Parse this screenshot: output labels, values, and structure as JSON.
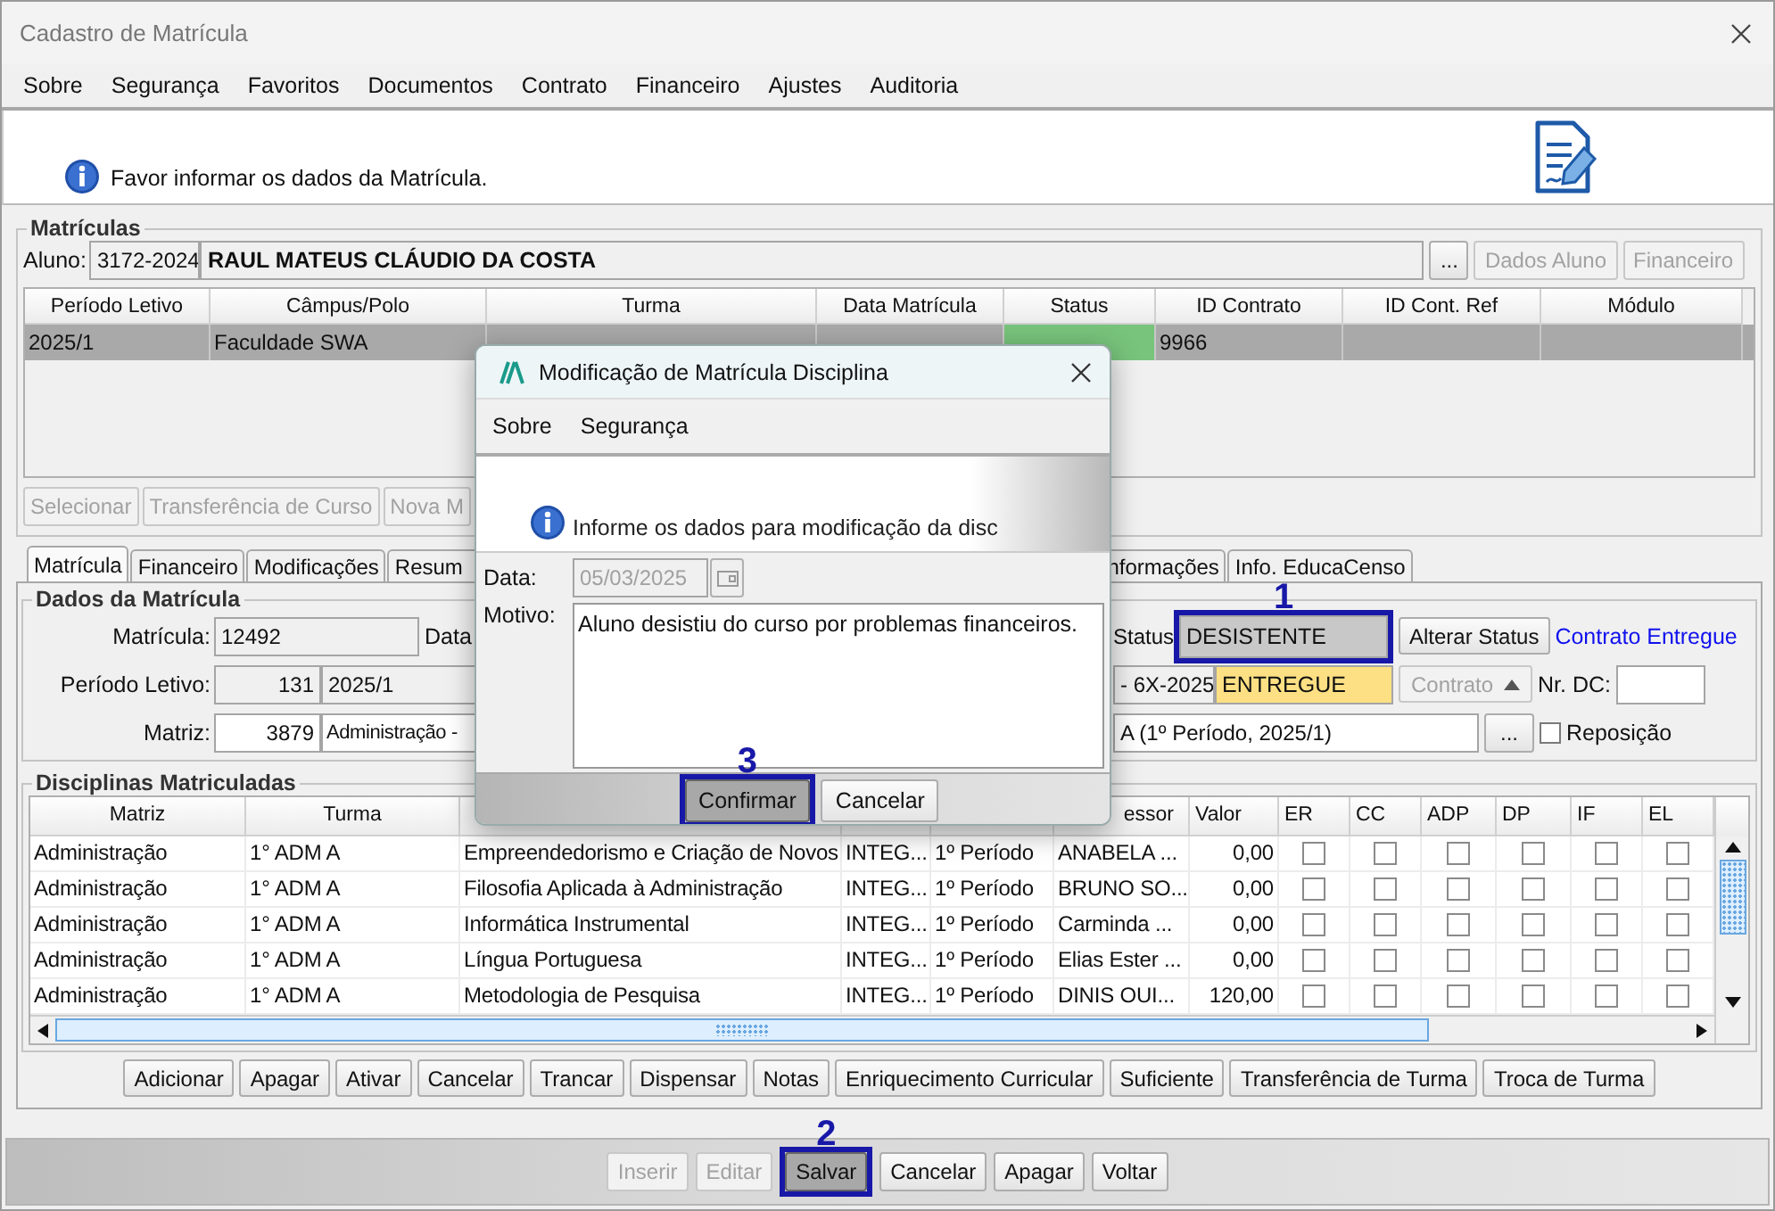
{
  "window": {
    "title": "Cadastro de Matrícula"
  },
  "menu": [
    "Sobre",
    "Segurança",
    "Favoritos",
    "Documentos",
    "Contrato",
    "Financeiro",
    "Ajustes",
    "Auditoria"
  ],
  "info": {
    "message": "Favor informar os dados da Matrícula."
  },
  "matriculas": {
    "title": "Matrículas",
    "aluno_label": "Aluno:",
    "aluno_code": "3172-2024",
    "aluno_name": "RAUL MATEUS CLÁUDIO DA COSTA",
    "buttons": [
      {
        "label": "...",
        "disabled": false
      },
      {
        "label": "Dados Aluno",
        "disabled": true
      },
      {
        "label": "Financeiro",
        "disabled": true
      }
    ],
    "columns": [
      "Período Letivo",
      "Câmpus/Polo",
      "Turma",
      "Data Matrícula",
      "Status",
      "ID Contrato",
      "ID Cont. Ref",
      "Módulo"
    ],
    "rows": [
      {
        "periodo": "2025/1",
        "campus": "Faculdade SWA",
        "id_contrato": "9966",
        "selected": true,
        "color": "#78c47c"
      }
    ],
    "actions": [
      {
        "label": "Selecionar",
        "disabled": true
      },
      {
        "label": "Transferência de Curso",
        "disabled": true
      },
      {
        "label": "Nova M",
        "disabled": true
      }
    ]
  },
  "tabs": [
    {
      "label": "Matrícula",
      "selected": true
    },
    {
      "label": "Financeiro",
      "selected": false
    },
    {
      "label": "Modificações",
      "selected": false
    },
    {
      "label": "Resum",
      "selected": false
    },
    {
      "label": "nformações",
      "selected": false
    },
    {
      "label": "Info. EducaCenso",
      "selected": false
    }
  ],
  "dados": {
    "title": "Dados da Matrícula",
    "matricula_label": "Matrícula:",
    "matricula": "12492",
    "data_label": "Data",
    "periodo_label": "Período Letivo:",
    "periodo_code": "131",
    "periodo": "2025/1",
    "matriz_label": "Matriz:",
    "matriz_code": "3879",
    "matriz": "Administração -",
    "status_label": "Status",
    "status": "DESISTENTE",
    "status_marker": "1",
    "alterar_status": "Alterar Status",
    "contrato_link": "Contrato Entregue",
    "turma": "- 6X-2025",
    "contrato_status": "ENTREGUE",
    "contrato_button": {
      "label": "Contrato",
      "disabled": true
    },
    "nr_dc_label": "Nr. DC:",
    "turma_desc": "A (1º Período, 2025/1)",
    "browse": "...",
    "reposicao": {
      "label": "Reposição",
      "checked": false
    }
  },
  "disciplinas": {
    "title": "Disciplinas Matriculadas",
    "columns": [
      "Matriz",
      "Turma",
      "essor",
      "Valor",
      "ER",
      "CC",
      "ADP",
      "DP",
      "IF",
      "EL"
    ],
    "rows": [
      {
        "matriz": "Administração",
        "turma": "1° ADM A",
        "disciplina": "Empreendedorismo e Criação de Novos",
        "tipo": "INTEG...",
        "periodo": "1º Período",
        "professor": "ANABELA ...",
        "valor": "0,00",
        "checks": [
          false,
          false,
          false,
          false,
          false,
          false
        ]
      },
      {
        "matriz": "Administração",
        "turma": "1° ADM A",
        "disciplina": "Filosofia Aplicada à Administração",
        "tipo": "INTEG...",
        "periodo": "1º Período",
        "professor": "BRUNO SO...",
        "valor": "0,00",
        "checks": [
          false,
          false,
          false,
          false,
          false,
          false
        ]
      },
      {
        "matriz": "Administração",
        "turma": "1° ADM A",
        "disciplina": "Informática Instrumental",
        "tipo": "INTEG...",
        "periodo": "1º Período",
        "professor": "Carminda ...",
        "valor": "0,00",
        "checks": [
          false,
          false,
          false,
          false,
          false,
          false
        ]
      },
      {
        "matriz": "Administração",
        "turma": "1° ADM A",
        "disciplina": "Língua Portuguesa",
        "tipo": "INTEG...",
        "periodo": "1º Período",
        "professor": "Elias Ester ...",
        "valor": "0,00",
        "checks": [
          false,
          false,
          false,
          false,
          false,
          false
        ]
      },
      {
        "matriz": "Administração",
        "turma": "1° ADM A",
        "disciplina": "Metodologia de Pesquisa",
        "tipo": "INTEG...",
        "periodo": "1º Período",
        "professor": "DINIS OUI...",
        "valor": "120,00",
        "checks": [
          false,
          false,
          false,
          false,
          false,
          false
        ]
      }
    ],
    "actions": [
      "Adicionar",
      "Apagar",
      "Ativar",
      "Cancelar",
      "Trancar",
      "Dispensar",
      "Notas",
      "Enriquecimento Curricular",
      "Suficiente",
      "Transferência de Turma",
      "Troca de Turma"
    ]
  },
  "footer": [
    {
      "label": "Inserir",
      "disabled": true,
      "pressed": false
    },
    {
      "label": "Editar",
      "disabled": true,
      "pressed": false
    },
    {
      "label": "Salvar",
      "disabled": false,
      "pressed": true,
      "marker": "2"
    },
    {
      "label": "Cancelar",
      "disabled": false,
      "pressed": false
    },
    {
      "label": "Apagar",
      "disabled": false,
      "pressed": false
    },
    {
      "label": "Voltar",
      "disabled": false,
      "pressed": false
    }
  ],
  "dialog": {
    "title": "Modificação de Matrícula Disciplina",
    "menu": [
      "Sobre",
      "Segurança"
    ],
    "message": "Informe os dados para modificação da disc",
    "data_label": "Data:",
    "data": "05/03/2025",
    "data_disabled": true,
    "motivo_label": "Motivo:",
    "motivo": "Aluno desistiu do curso por problemas financeiros.",
    "buttons": [
      {
        "label": "Confirmar",
        "pressed": true,
        "marker": "3"
      },
      {
        "label": "Cancelar",
        "pressed": false
      }
    ]
  }
}
